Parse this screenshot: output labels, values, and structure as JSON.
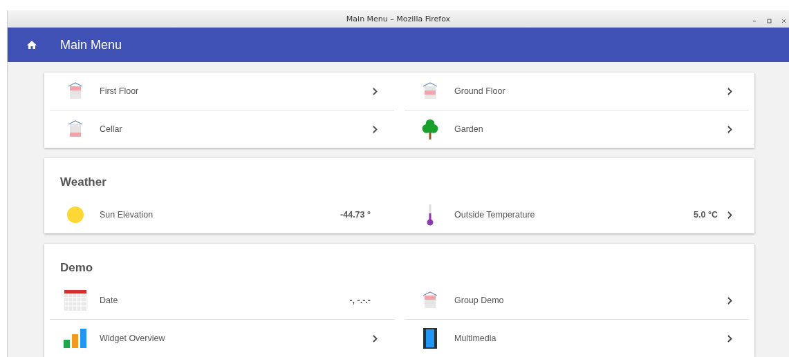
{
  "window": {
    "title": "Main Menu – Mozilla Firefox"
  },
  "app_bar": {
    "title": "Main Menu"
  },
  "cards": [
    {
      "items": [
        {
          "label": "First Floor",
          "kind": "house-upper",
          "link": true
        },
        {
          "label": "Ground Floor",
          "kind": "house-lower",
          "link": true
        },
        {
          "label": "Cellar",
          "kind": "house-cellar",
          "link": true
        },
        {
          "label": "Garden",
          "kind": "tree",
          "link": true
        }
      ]
    },
    {
      "title": "Weather",
      "items": [
        {
          "label": "Sun Elevation",
          "kind": "sun",
          "value": "-44.73 °",
          "link": false
        },
        {
          "label": "Outside Temperature",
          "kind": "thermometer",
          "value": "5.0 °C",
          "link": true
        }
      ]
    },
    {
      "title": "Demo",
      "items": [
        {
          "label": "Date",
          "kind": "calendar",
          "value": "-, -.-.-",
          "link": false
        },
        {
          "label": "Group Demo",
          "kind": "house-upper",
          "link": true
        },
        {
          "label": "Widget Overview",
          "kind": "chart",
          "link": true
        },
        {
          "label": "Multimedia",
          "kind": "film",
          "link": true
        }
      ]
    }
  ]
}
